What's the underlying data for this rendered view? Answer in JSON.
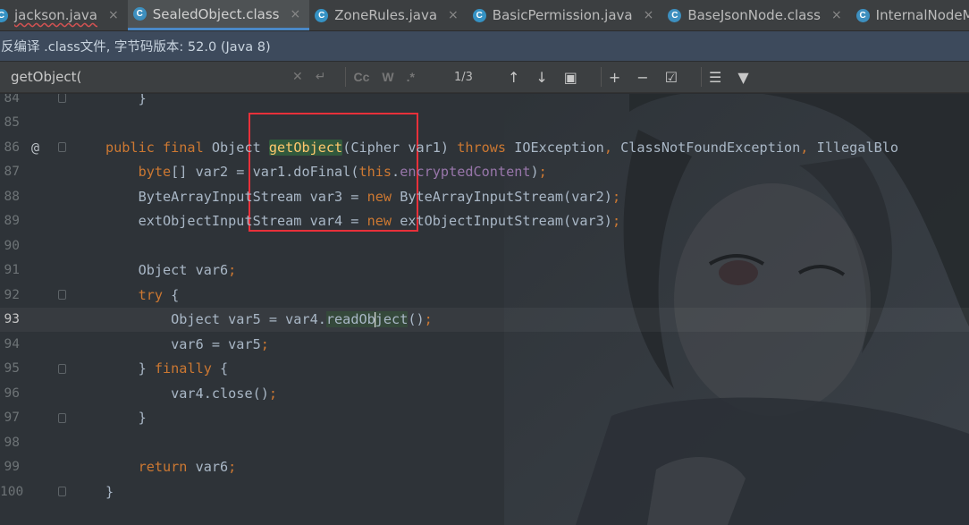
{
  "tabs": [
    {
      "label": "jackson.java",
      "icon": "java-class-icon",
      "icon_letter": "C",
      "has_error": true,
      "active": false
    },
    {
      "label": "SealedObject.class",
      "icon": "compiled-class-icon",
      "icon_letter": "C",
      "has_error": false,
      "active": true
    },
    {
      "label": "ZoneRules.java",
      "icon": "java-class-icon",
      "icon_letter": "C",
      "has_error": false,
      "active": false
    },
    {
      "label": "BasicPermission.java",
      "icon": "java-class-icon",
      "icon_letter": "C",
      "has_error": false,
      "active": false
    },
    {
      "label": "BaseJsonNode.class",
      "icon": "compiled-class-icon",
      "icon_letter": "C",
      "has_error": false,
      "active": false
    },
    {
      "label": "InternalNodeMap",
      "icon": "compiled-class-icon",
      "icon_letter": "C",
      "has_error": false,
      "active": false
    }
  ],
  "close_glyph": "×",
  "notice": "反编译 .class文件, 字节码版本: 52.0 (Java 8)",
  "search": {
    "query": "getObject(",
    "match_count": "1/3",
    "opt_case": "Cc",
    "opt_words": "W",
    "opt_regex": ".*"
  },
  "lines": [
    {
      "num": "84",
      "tokens": [
        {
          "t": "    }",
          "c": "plain"
        }
      ]
    },
    {
      "num": "85",
      "tokens": []
    },
    {
      "num": "86",
      "annot": "@",
      "tokens": [
        {
          "t": "public final ",
          "c": "kw"
        },
        {
          "t": "Object ",
          "c": "plain"
        },
        {
          "t": "getObject",
          "c": "hl"
        },
        {
          "t": "(Cipher var1) ",
          "c": "plain"
        },
        {
          "t": "throws ",
          "c": "kw"
        },
        {
          "t": "IOException",
          "c": "plain"
        },
        {
          "t": ", ",
          "c": "kw"
        },
        {
          "t": "ClassNotFoundException",
          "c": "plain"
        },
        {
          "t": ", ",
          "c": "kw"
        },
        {
          "t": "IllegalBlo",
          "c": "plain"
        }
      ]
    },
    {
      "num": "87",
      "tokens": [
        {
          "t": "    ",
          "c": "plain"
        },
        {
          "t": "byte",
          "c": "kw"
        },
        {
          "t": "[] var2 = var1.doFinal(",
          "c": "plain"
        },
        {
          "t": "this",
          "c": "kw"
        },
        {
          "t": ".",
          "c": "plain"
        },
        {
          "t": "encryptedContent",
          "c": "fld"
        },
        {
          "t": ")",
          "c": "plain"
        },
        {
          "t": ";",
          "c": "kw"
        }
      ]
    },
    {
      "num": "88",
      "tokens": [
        {
          "t": "    ByteArrayInputStream var3 = ",
          "c": "plain"
        },
        {
          "t": "new ",
          "c": "kw"
        },
        {
          "t": "ByteArrayInputStream(var2)",
          "c": "plain"
        },
        {
          "t": ";",
          "c": "kw"
        }
      ]
    },
    {
      "num": "89",
      "tokens": [
        {
          "t": "    extObjectInputStream var4 = ",
          "c": "plain"
        },
        {
          "t": "new ",
          "c": "kw"
        },
        {
          "t": "extObjectInputStream(var3)",
          "c": "plain"
        },
        {
          "t": ";",
          "c": "kw"
        }
      ]
    },
    {
      "num": "90",
      "tokens": []
    },
    {
      "num": "91",
      "tokens": [
        {
          "t": "    Object var6",
          "c": "plain"
        },
        {
          "t": ";",
          "c": "kw"
        }
      ]
    },
    {
      "num": "92",
      "tokens": [
        {
          "t": "    ",
          "c": "plain"
        },
        {
          "t": "try ",
          "c": "kw"
        },
        {
          "t": "{",
          "c": "plain"
        }
      ]
    },
    {
      "num": "93",
      "current": true,
      "tokens": [
        {
          "t": "        Object var5 = var4.",
          "c": "plain"
        },
        {
          "t": "readOb",
          "c": "hl2"
        },
        {
          "t": "|",
          "c": "caret"
        },
        {
          "t": "ject",
          "c": "hl2"
        },
        {
          "t": "()",
          "c": "plain"
        },
        {
          "t": ";",
          "c": "kw"
        }
      ]
    },
    {
      "num": "94",
      "tokens": [
        {
          "t": "        var6 = var5",
          "c": "plain"
        },
        {
          "t": ";",
          "c": "kw"
        }
      ]
    },
    {
      "num": "95",
      "tokens": [
        {
          "t": "    } ",
          "c": "plain"
        },
        {
          "t": "finally ",
          "c": "kw"
        },
        {
          "t": "{",
          "c": "plain"
        }
      ]
    },
    {
      "num": "96",
      "tokens": [
        {
          "t": "        var4.close()",
          "c": "plain"
        },
        {
          "t": ";",
          "c": "kw"
        }
      ]
    },
    {
      "num": "97",
      "tokens": [
        {
          "t": "    }",
          "c": "plain"
        }
      ]
    },
    {
      "num": "98",
      "tokens": []
    },
    {
      "num": "99",
      "tokens": [
        {
          "t": "    ",
          "c": "plain"
        },
        {
          "t": "return ",
          "c": "kw"
        },
        {
          "t": "var6",
          "c": "plain"
        },
        {
          "t": ";",
          "c": "kw"
        }
      ]
    },
    {
      "num": "100",
      "tokens": [
        {
          "t": "}",
          "c": "plain"
        }
      ]
    }
  ],
  "colors": {
    "keyword": "#cc7832",
    "function": "#ffc66d",
    "field": "#9876aa",
    "text": "#a9b7c6",
    "match_highlight": "#32593d",
    "annotation_box": "#e8303a"
  }
}
